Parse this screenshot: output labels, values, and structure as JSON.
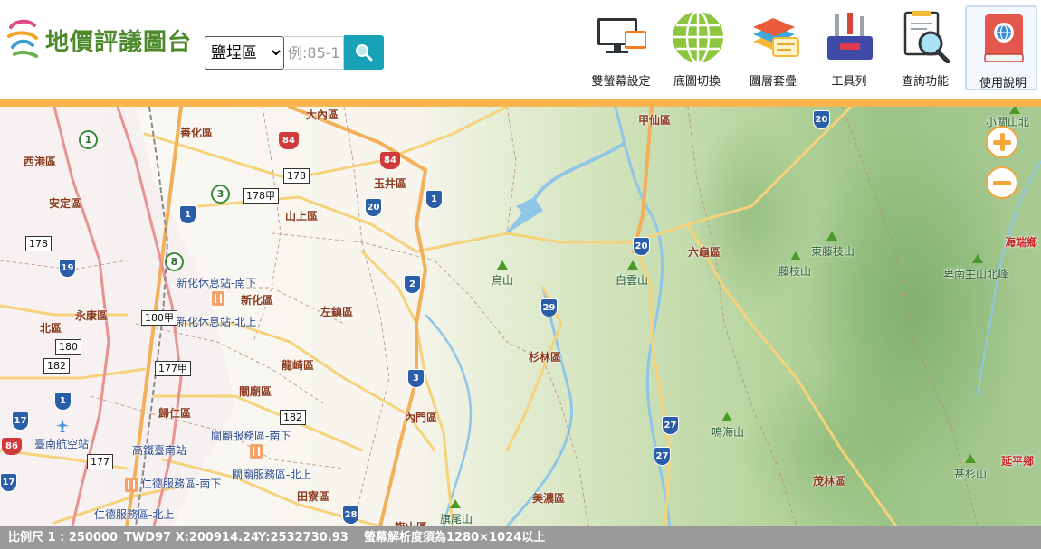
{
  "header": {
    "app_title": "地價評議圖台",
    "district_select": {
      "selected": "鹽埕區",
      "options": [
        "鹽埕區"
      ]
    },
    "lot_input": {
      "value": "",
      "placeholder": "例:85-1"
    },
    "search_icon": "search-icon",
    "tools": [
      {
        "label": "雙螢幕設定",
        "icon": "dual-screen-icon"
      },
      {
        "label": "底圖切換",
        "icon": "globe-icon"
      },
      {
        "label": "圖層套疊",
        "icon": "layers-icon"
      },
      {
        "label": "工具列",
        "icon": "toolbox-icon"
      },
      {
        "label": "查詢功能",
        "icon": "magnifier-document-icon"
      },
      {
        "label": "使用說明",
        "icon": "manual-book-icon"
      }
    ],
    "accent_color": "#f9b64f"
  },
  "map": {
    "zoom": {
      "in_icon": "plus-icon",
      "out_icon": "minus-icon"
    },
    "districts": [
      "大內區",
      "善化區",
      "西港區",
      "安定區",
      "玉井區",
      "山上區",
      "新化區",
      "左鎮區",
      "永康區",
      "北區",
      "龍崎區",
      "關廟區",
      "歸仁區",
      "內門區",
      "田寮區",
      "旗山區",
      "美濃區",
      "杉林區",
      "甲仙區",
      "六龜區",
      "茂林區",
      "延平鄉",
      "海端鄉"
    ],
    "service_areas": [
      "新化休息站-南下",
      "新化休息站-北上",
      "關廟服務區-南下",
      "關廟服務區-北上",
      "仁德服務區-南下",
      "仁德服務區-北上",
      "高鐵臺南站",
      "臺南航空站"
    ],
    "mountains": [
      "烏山",
      "白雲山",
      "鳴海山",
      "旗尾山",
      "東藤枝山",
      "藤枝山",
      "卑南主山北峰",
      "甚杉山",
      "小關山北"
    ],
    "route_shields": [
      "1",
      "3",
      "19",
      "20",
      "3",
      "20",
      "2",
      "29",
      "3",
      "27",
      "27",
      "28",
      "17",
      "17",
      "1",
      "84",
      "84",
      "86"
    ],
    "county_road_labels": [
      "178",
      "178甲",
      "178",
      "180甲",
      "180",
      "182",
      "177甲",
      "182",
      "177"
    ],
    "provincial_circles": [
      "1",
      "3",
      "8"
    ]
  },
  "status": {
    "scale": "比例尺 1 : 250000",
    "coords": "TWD97 X:200914.24",
    "y_coord": "Y:2532730.93",
    "note": "螢幕解析度須為1280×1024以上"
  }
}
